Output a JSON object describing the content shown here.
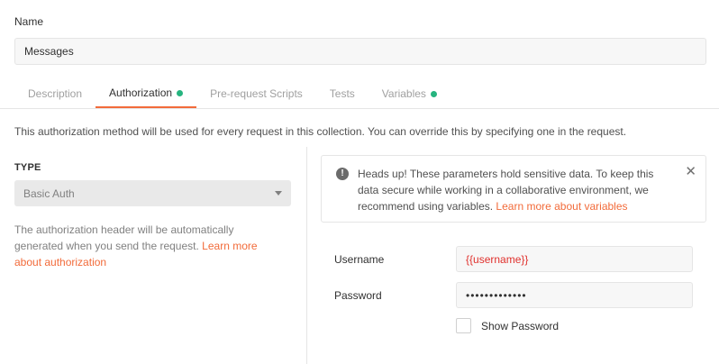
{
  "name": {
    "label": "Name",
    "value": "Messages"
  },
  "tabs": [
    {
      "label": "Description",
      "active": false,
      "dot": false
    },
    {
      "label": "Authorization",
      "active": true,
      "dot": true
    },
    {
      "label": "Pre-request Scripts",
      "active": false,
      "dot": false
    },
    {
      "label": "Tests",
      "active": false,
      "dot": false
    },
    {
      "label": "Variables",
      "active": false,
      "dot": true
    }
  ],
  "intro": "This authorization method will be used for every request in this collection. You can override this by specifying one in the request.",
  "type": {
    "label": "TYPE",
    "selected": "Basic Auth"
  },
  "auth_description": {
    "text": "The authorization header will be automatically generated when you send the request.",
    "link": "Learn more about authorization"
  },
  "alert": {
    "icon": "alert-circle-icon",
    "text": "Heads up! These parameters hold sensitive data. To keep this data secure while working in a collaborative environment, we recommend using variables.",
    "link": "Learn more about variables",
    "close": "✕"
  },
  "username": {
    "label": "Username",
    "value": "{{username}}"
  },
  "password": {
    "label": "Password",
    "value": "•••••••••••••"
  },
  "show_password": {
    "label": "Show Password",
    "checked": false
  },
  "colors": {
    "accent": "#f26b3a",
    "dot": "#26b47f",
    "variable": "#e0302c"
  }
}
